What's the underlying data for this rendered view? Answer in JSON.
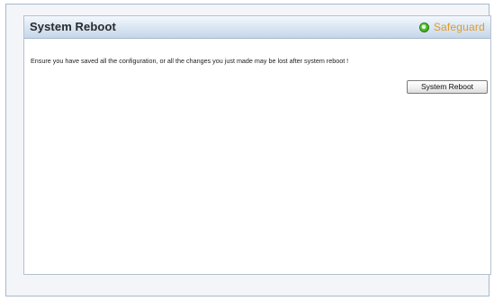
{
  "page": {
    "title": "System Reboot",
    "safeguard_label": "Safeguard",
    "safeguard_icon": "status-dot-icon",
    "safeguard_color": "#e39a2a",
    "message": "Ensure you have saved all the configuration, or all the changes you just made may be lost after system reboot !",
    "reboot_button_label": "System Reboot"
  }
}
